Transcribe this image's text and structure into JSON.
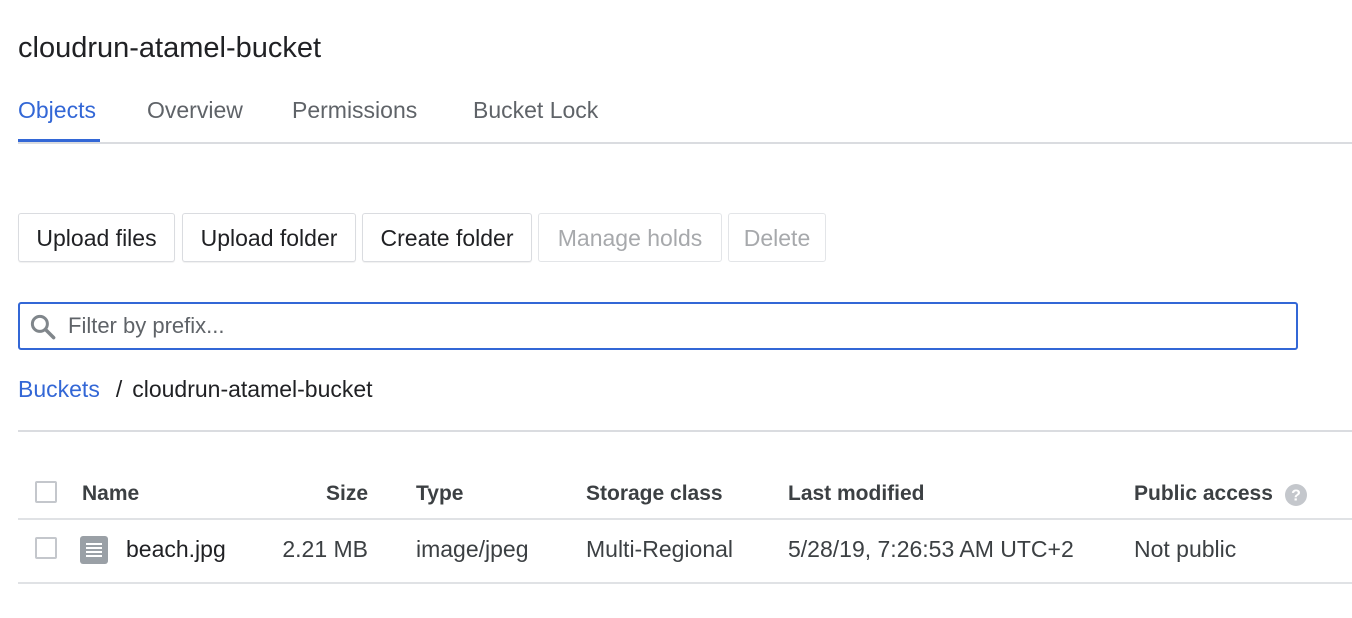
{
  "page": {
    "title": "cloudrun-atamel-bucket"
  },
  "tabs": [
    {
      "label": "Objects",
      "active": true
    },
    {
      "label": "Overview",
      "active": false
    },
    {
      "label": "Permissions",
      "active": false
    },
    {
      "label": "Bucket Lock",
      "active": false
    }
  ],
  "toolbar": {
    "upload_files": "Upload files",
    "upload_folder": "Upload folder",
    "create_folder": "Create folder",
    "manage_holds": "Manage holds",
    "delete": "Delete"
  },
  "filter": {
    "placeholder": "Filter by prefix...",
    "value": ""
  },
  "breadcrumb": {
    "root": "Buckets",
    "separator": "/",
    "current": "cloudrun-atamel-bucket"
  },
  "table": {
    "columns": {
      "name": "Name",
      "size": "Size",
      "type": "Type",
      "storage_class": "Storage class",
      "last_modified": "Last modified",
      "public_access": "Public access"
    },
    "rows": [
      {
        "name": "beach.jpg",
        "size": "2.21 MB",
        "type": "image/jpeg",
        "storage_class": "Multi-Regional",
        "last_modified": "5/28/19, 7:26:53 AM UTC+2",
        "public_access": "Not public",
        "icon": "file-icon"
      }
    ]
  },
  "colors": {
    "accent": "#3367d6",
    "text": "#202124",
    "muted": "#5f6368",
    "divider": "#dadce0"
  }
}
